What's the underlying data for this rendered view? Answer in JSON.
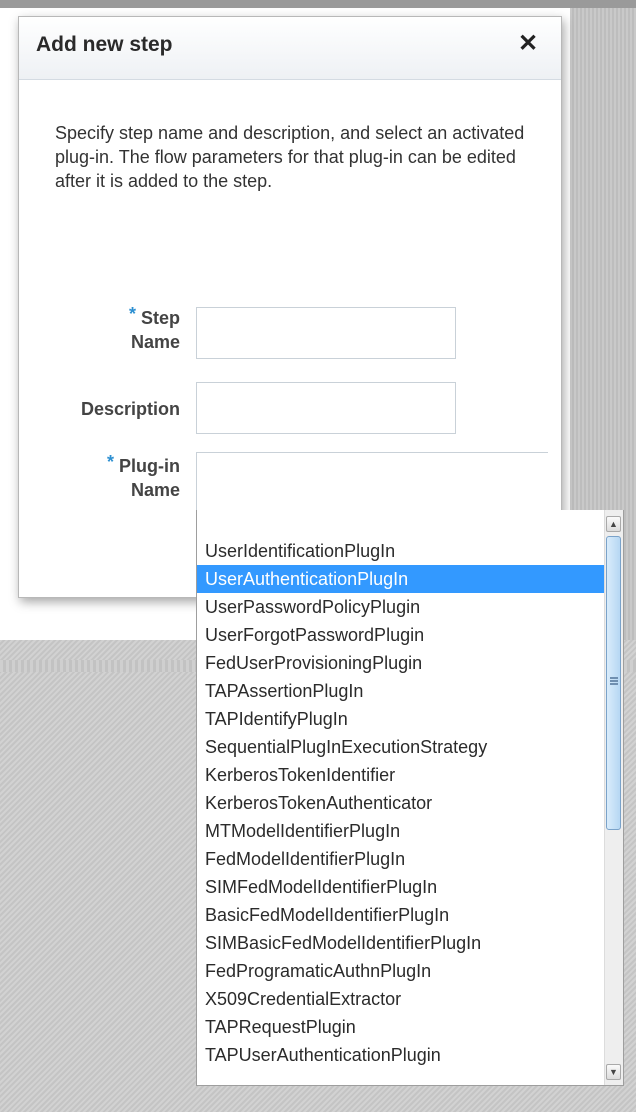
{
  "dialog": {
    "title": "Add new step",
    "close_glyph": "✕",
    "instructions": "Specify step name and description, and select an activated plug-in. The flow parameters for that plug-in can be edited after it is added to the step."
  },
  "form": {
    "required_mark": "*",
    "step_name": {
      "label_line1": "Step",
      "label_line2": "Name",
      "value": ""
    },
    "description": {
      "label": "Description",
      "value": ""
    },
    "plugin_name": {
      "label_line1": "Plug-in",
      "label_line2": "Name",
      "value": ""
    }
  },
  "dropdown": {
    "selected_index": 1,
    "items": [
      "UserIdentificationPlugIn",
      "UserAuthenticationPlugIn",
      "UserPasswordPolicyPlugin",
      "UserForgotPasswordPlugin",
      "FedUserProvisioningPlugin",
      "TAPAssertionPlugIn",
      "TAPIdentifyPlugIn",
      "SequentialPlugInExecutionStrategy",
      "KerberosTokenIdentifier",
      "KerberosTokenAuthenticator",
      "MTModelIdentifierPlugIn",
      "FedModelIdentifierPlugIn",
      "SIMFedModelIdentifierPlugIn",
      "BasicFedModelIdentifierPlugIn",
      "SIMBasicFedModelIdentifierPlugIn",
      "FedProgramaticAuthnPlugIn",
      "X509CredentialExtractor",
      "TAPRequestPlugin",
      "TAPUserAuthenticationPlugin"
    ],
    "scroll_up_glyph": "▲",
    "scroll_down_glyph": "▼"
  },
  "colors": {
    "selection": "#3399ff",
    "required_star": "#2d8fd1"
  }
}
